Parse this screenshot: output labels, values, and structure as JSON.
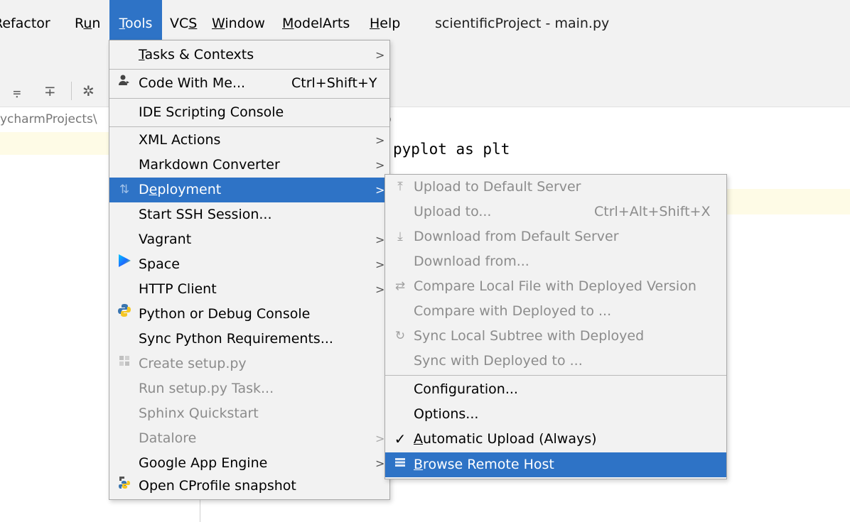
{
  "menubar": {
    "items": [
      {
        "label": "Refactor"
      },
      {
        "label_pre": "R",
        "label_mn": "u",
        "label_post": "n"
      },
      {
        "label_pre": "",
        "label_mn": "T",
        "label_post": "ools"
      },
      {
        "label_pre": "VC",
        "label_mn": "S",
        "label_post": ""
      },
      {
        "label_pre": "",
        "label_mn": "W",
        "label_post": "indow"
      },
      {
        "label_pre": "",
        "label_mn": "M",
        "label_post": "odelArts"
      },
      {
        "label_pre": "",
        "label_mn": "H",
        "label_post": "elp"
      }
    ],
    "window_title": "scientificProject - main.py"
  },
  "editor": {
    "breadcrumb": "ycharmProjects\\",
    "breadcrumb_tail": "b",
    "code_line": "pyplot as plt"
  },
  "tools_menu": {
    "items": [
      {
        "pre": "",
        "mn": "T",
        "post": "asks & Contexts",
        "arrow": ">"
      },
      {
        "label": "Code With Me...",
        "shortcut": "Ctrl+Shift+Y",
        "icon": "user-icon"
      },
      {
        "label": "IDE Scripting Console"
      },
      {
        "label": "XML Actions",
        "arrow": ">"
      },
      {
        "label": "Markdown Converter",
        "arrow": ">"
      },
      {
        "pre": "D",
        "mn": "e",
        "post": "ployment",
        "arrow": ">",
        "icon": "deploy-icon"
      },
      {
        "label": "Start SSH Session..."
      },
      {
        "label": "Vagrant",
        "arrow": ">"
      },
      {
        "label": "Space",
        "arrow": ">",
        "icon": "space-icon"
      },
      {
        "label": "HTTP Client",
        "arrow": ">"
      },
      {
        "label": "Python or Debug Console",
        "icon": "python-icon"
      },
      {
        "label": "Sync Python Requirements..."
      },
      {
        "label": "Create setup.py",
        "icon": "package-icon"
      },
      {
        "label": "Run setup.py Task..."
      },
      {
        "label": "Sphinx Quickstart"
      },
      {
        "label": "Datalore",
        "arrow": ">"
      },
      {
        "label": "Google App Engine",
        "arrow": ">"
      },
      {
        "label": "Open CProfile snapshot",
        "icon": "profile-icon"
      }
    ]
  },
  "deploy_menu": {
    "items": [
      {
        "label": "Upload to Default Server",
        "icon": "upload-icon"
      },
      {
        "label": "Upload to...",
        "shortcut": "Ctrl+Alt+Shift+X"
      },
      {
        "label": "Download from Default Server",
        "icon": "download-icon"
      },
      {
        "label": "Download from..."
      },
      {
        "label": "Compare Local File with Deployed Version",
        "icon": "compare-icon"
      },
      {
        "label": "Compare with Deployed to ..."
      },
      {
        "label": "Sync Local Subtree with Deployed",
        "icon": "sync-icon"
      },
      {
        "label": "Sync with Deployed to ..."
      },
      {
        "label": "Configuration..."
      },
      {
        "label": "Options..."
      },
      {
        "pre": "",
        "mn": "A",
        "post": "utomatic Upload (Always)",
        "check": "✓"
      },
      {
        "pre": "",
        "mn": "B",
        "post": "rowse Remote Host",
        "icon": "server-icon"
      }
    ]
  },
  "colors": {
    "selection": "#2e73c6",
    "menu_bg": "#f2f2f2",
    "disabled_text": "#8c8c8c"
  }
}
